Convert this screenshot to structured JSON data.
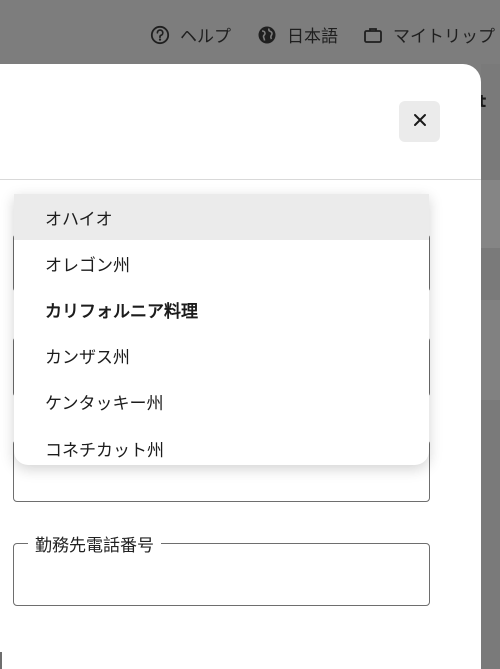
{
  "nav": {
    "help_label": "ヘルプ",
    "language_label": "日本語",
    "trips_label": "マイトリップ",
    "help_icon": "question-circle-icon",
    "language_icon": "globe-icon",
    "trips_icon": "briefcase-icon"
  },
  "background": {
    "partial_text": "tt"
  },
  "modal": {
    "close_icon": "close-icon"
  },
  "dropdown": {
    "items": [
      {
        "label": "オハイオ"
      },
      {
        "label": "オレゴン州"
      },
      {
        "label": "カリフォルニア料理"
      },
      {
        "label": "カンザス州"
      },
      {
        "label": "ケンタッキー州"
      },
      {
        "label": "コネチカット州"
      }
    ]
  },
  "form": {
    "phone_label": "勤務先電話番号"
  },
  "colors": {
    "overlay": "#7d7d7d",
    "modal_bg": "#ffffff",
    "highlight": "#ebebeb",
    "border": "#6e6e6e"
  }
}
